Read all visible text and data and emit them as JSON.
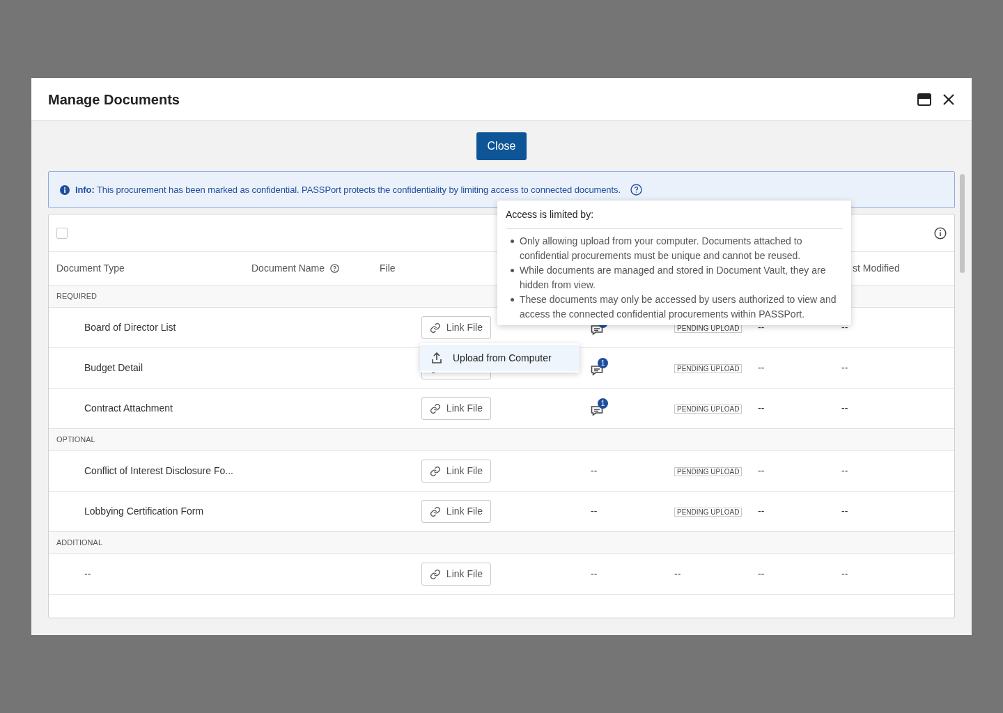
{
  "dialog": {
    "title": "Manage Documents",
    "close_button": "Close"
  },
  "info": {
    "label": "Info:",
    "text": "This procurement has been marked as confidential. PASSPort protects the confidentiality by limiting access to connected documents."
  },
  "tooltip": {
    "title": "Access is limited by:",
    "items": [
      "Only allowing upload from your computer. Documents attached to confidential procurements must be unique and cannot be reused.",
      "While documents are managed and stored in Document Vault, they are hidden from view.",
      "These documents may only be accessed by users authorized to view and access the connected confidential procurements within PASSPort."
    ]
  },
  "table": {
    "select_all": {
      "checked": false
    },
    "columns": [
      "Document Type",
      "Document Name",
      "File",
      "",
      "",
      "",
      "st Modified"
    ],
    "groups": [
      {
        "label": "REQUIRED",
        "rows": [
          {
            "type": "Board of Director List",
            "file": "Link File",
            "comments": {
              "kind": "icon"
            },
            "status": {
              "kind": "badge",
              "text": "PENDING UPLOAD"
            },
            "column_7": "--",
            "column_8": "--"
          },
          {
            "type": "Budget Detail",
            "comments": {
              "kind": "icon",
              "badge": "1"
            },
            "status": {
              "kind": "badge",
              "text": "PENDING UPLOAD"
            },
            "column_7": "--",
            "column_8": "--"
          },
          {
            "type": "Contract Attachment",
            "file": "Link File",
            "comments": {
              "kind": "icon",
              "badge": "1"
            },
            "status": {
              "kind": "badge",
              "text": "PENDING UPLOAD"
            },
            "column_7": "--",
            "column_8": "--"
          }
        ]
      },
      {
        "label": "OPTIONAL",
        "rows": [
          {
            "type": "Conflict of Interest Disclosure Fo...",
            "file": "Link File",
            "comments": {
              "kind": "text",
              "text": "--"
            },
            "status": {
              "kind": "badge",
              "text": "PENDING UPLOAD"
            },
            "column_7": "--",
            "column_8": "--"
          },
          {
            "type": "Lobbying Certification Form",
            "file": "Link File",
            "comments": {
              "kind": "text",
              "text": "--"
            },
            "status": {
              "kind": "badge",
              "text": "PENDING UPLOAD"
            },
            "column_7": "--",
            "column_8": "--"
          }
        ]
      },
      {
        "label": "ADDITIONAL",
        "rows": [
          {
            "type": "--",
            "file": "Link File",
            "comments": {
              "kind": "text",
              "text": "--"
            },
            "status": {
              "kind": "text",
              "text": "--"
            },
            "column_7": "--",
            "column_8": "--"
          }
        ]
      }
    ]
  },
  "menu": {
    "items": [
      {
        "label": "Upload from Computer",
        "selected": true
      }
    ]
  }
}
